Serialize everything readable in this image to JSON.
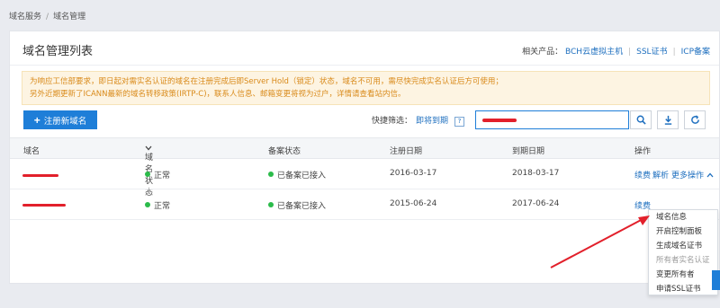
{
  "breadcrumb": {
    "parent": "域名服务",
    "current": "域名管理",
    "separator": "/"
  },
  "header": {
    "title": "域名管理列表",
    "related_label": "相关产品：",
    "related_links": [
      "BCH云虚拟主机",
      "SSL证书",
      "ICP备案"
    ]
  },
  "notice": {
    "line1": "为响应工信部要求，即日起对需实名认证的域名在注册完成后即Server Hold（锁定）状态，域名不可用，需尽快完成实名认证后方可使用；",
    "line2": "另外近期更新了ICANN最新的域名转移政策(IRTP-C)，联系人信息、邮箱变更将视为过户，详情请查看站内信。"
  },
  "toolbar": {
    "add_label": "注册新域名",
    "quick_label": "快捷筛选：",
    "quick_link": "即将到期",
    "help": "?",
    "search_icon": "search-icon",
    "download_icon": "download-icon",
    "refresh_icon": "refresh-icon"
  },
  "table": {
    "columns": [
      "域名",
      "域名状态",
      "备案状态",
      "注册日期",
      "到期日期",
      "操作"
    ],
    "rows": [
      {
        "status": "正常",
        "icp": "已备案已接入",
        "reg_date": "2016-03-17",
        "exp_date": "2018-03-17",
        "renew": "续费",
        "resolve": "解析",
        "more": "更多操作"
      },
      {
        "status": "正常",
        "icp": "已备案已接入",
        "reg_date": "2015-06-24",
        "exp_date": "2017-06-24",
        "renew": "续费"
      }
    ]
  },
  "dropdown": {
    "items": [
      "域名信息",
      "开启控制面板",
      "生成域名证书",
      "所有者实名认证",
      "变更所有者",
      "申请SSL证书"
    ]
  },
  "colors": {
    "primary": "#1e7ed8",
    "ok": "#2bbb4a",
    "annotation": "#e2202b",
    "notice_text": "#d98a1a"
  }
}
